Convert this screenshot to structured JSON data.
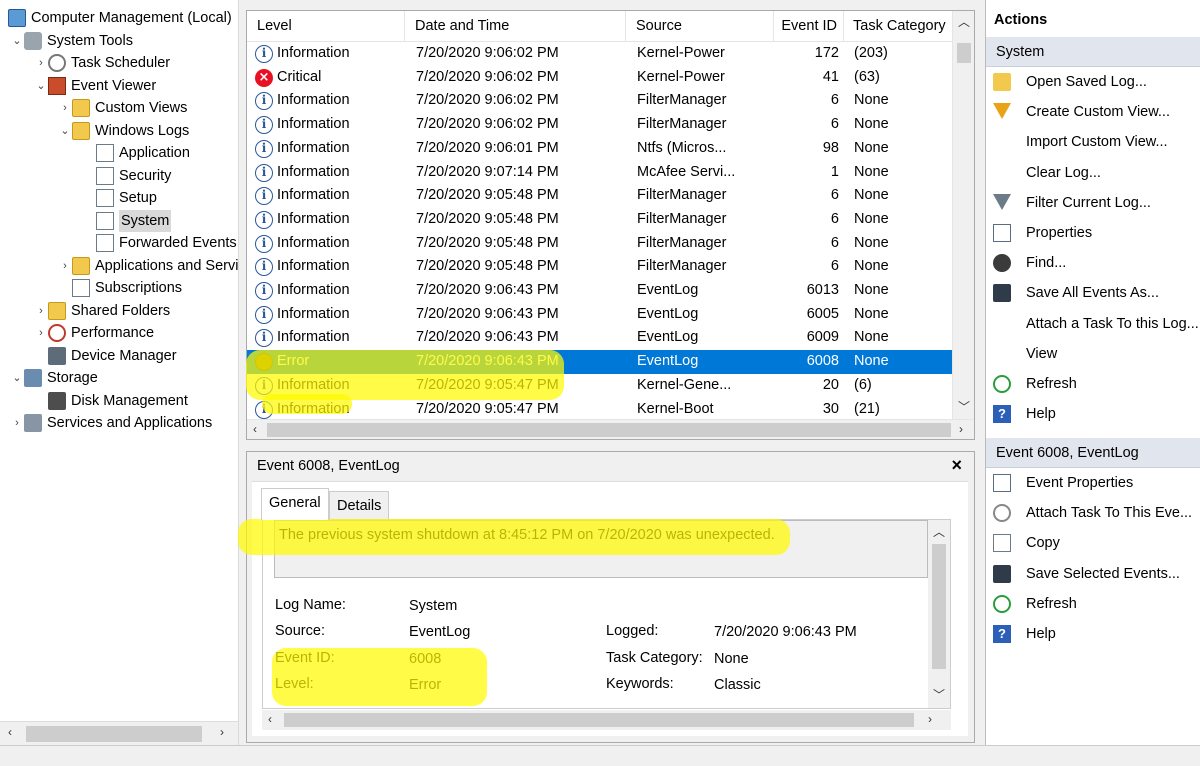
{
  "tree": {
    "items": [
      {
        "label": "Computer Management (Local)",
        "indent": 0,
        "chevron": "",
        "icon": "monitor-icon"
      },
      {
        "label": "System Tools",
        "indent": 1,
        "chevron": "⌄",
        "icon": "tools-icon"
      },
      {
        "label": "Task Scheduler",
        "indent": 2,
        "chevron": "›",
        "icon": "clock-icon"
      },
      {
        "label": "Event Viewer",
        "indent": 2,
        "chevron": "⌄",
        "icon": "event-viewer-icon"
      },
      {
        "label": "Custom Views",
        "indent": 3,
        "chevron": "›",
        "icon": "folder-icon"
      },
      {
        "label": "Windows Logs",
        "indent": 3,
        "chevron": "⌄",
        "icon": "folder-icon"
      },
      {
        "label": "Application",
        "indent": 4,
        "chevron": "",
        "icon": "log-icon"
      },
      {
        "label": "Security",
        "indent": 4,
        "chevron": "",
        "icon": "log-icon"
      },
      {
        "label": "Setup",
        "indent": 4,
        "chevron": "",
        "icon": "log-icon"
      },
      {
        "label": "System",
        "indent": 4,
        "chevron": "",
        "icon": "log-icon"
      },
      {
        "label": "Forwarded Events",
        "indent": 4,
        "chevron": "",
        "icon": "log-icon"
      },
      {
        "label": "Applications and Services Logs",
        "indent": 3,
        "chevron": "›",
        "icon": "folder-icon"
      },
      {
        "label": "Subscriptions",
        "indent": 3,
        "chevron": "",
        "icon": "log-icon"
      },
      {
        "label": "Shared Folders",
        "indent": 2,
        "chevron": "›",
        "icon": "shared-folder-icon"
      },
      {
        "label": "Performance",
        "indent": 2,
        "chevron": "›",
        "icon": "performance-icon"
      },
      {
        "label": "Device Manager",
        "indent": 2,
        "chevron": "",
        "icon": "device-manager-icon"
      },
      {
        "label": "Storage",
        "indent": 1,
        "chevron": "⌄",
        "icon": "storage-icon"
      },
      {
        "label": "Disk Management",
        "indent": 2,
        "chevron": "",
        "icon": "disk-icon"
      },
      {
        "label": "Services and Applications",
        "indent": 1,
        "chevron": "›",
        "icon": "services-icon"
      }
    ],
    "selected": "System"
  },
  "list": {
    "columns": [
      "Level",
      "Date and Time",
      "Source",
      "Event ID",
      "Task Category"
    ],
    "rows": [
      {
        "level": "Information",
        "icon": "info-icon",
        "date": "7/20/2020 9:06:02 PM",
        "source": "Kernel-Power",
        "id": "172",
        "cat": "(203)"
      },
      {
        "level": "Critical",
        "icon": "critical-icon",
        "date": "7/20/2020 9:06:02 PM",
        "source": "Kernel-Power",
        "id": "41",
        "cat": "(63)"
      },
      {
        "level": "Information",
        "icon": "info-icon",
        "date": "7/20/2020 9:06:02 PM",
        "source": "FilterManager",
        "id": "6",
        "cat": "None"
      },
      {
        "level": "Information",
        "icon": "info-icon",
        "date": "7/20/2020 9:06:02 PM",
        "source": "FilterManager",
        "id": "6",
        "cat": "None"
      },
      {
        "level": "Information",
        "icon": "info-icon",
        "date": "7/20/2020 9:06:01 PM",
        "source": "Ntfs (Micros...",
        "id": "98",
        "cat": "None"
      },
      {
        "level": "Information",
        "icon": "info-icon",
        "date": "7/20/2020 9:07:14 PM",
        "source": "McAfee Servi...",
        "id": "1",
        "cat": "None"
      },
      {
        "level": "Information",
        "icon": "info-icon",
        "date": "7/20/2020 9:05:48 PM",
        "source": "FilterManager",
        "id": "6",
        "cat": "None"
      },
      {
        "level": "Information",
        "icon": "info-icon",
        "date": "7/20/2020 9:05:48 PM",
        "source": "FilterManager",
        "id": "6",
        "cat": "None"
      },
      {
        "level": "Information",
        "icon": "info-icon",
        "date": "7/20/2020 9:05:48 PM",
        "source": "FilterManager",
        "id": "6",
        "cat": "None"
      },
      {
        "level": "Information",
        "icon": "info-icon",
        "date": "7/20/2020 9:05:48 PM",
        "source": "FilterManager",
        "id": "6",
        "cat": "None"
      },
      {
        "level": "Information",
        "icon": "info-icon",
        "date": "7/20/2020 9:06:43 PM",
        "source": "EventLog",
        "id": "6013",
        "cat": "None"
      },
      {
        "level": "Information",
        "icon": "info-icon",
        "date": "7/20/2020 9:06:43 PM",
        "source": "EventLog",
        "id": "6005",
        "cat": "None"
      },
      {
        "level": "Information",
        "icon": "info-icon",
        "date": "7/20/2020 9:06:43 PM",
        "source": "EventLog",
        "id": "6009",
        "cat": "None"
      },
      {
        "level": "Error",
        "icon": "error-icon",
        "date": "7/20/2020 9:06:43 PM",
        "source": "EventLog",
        "id": "6008",
        "cat": "None",
        "selected": true
      },
      {
        "level": "Information",
        "icon": "info-icon",
        "date": "7/20/2020 9:05:47 PM",
        "source": "Kernel-Gene...",
        "id": "20",
        "cat": "(6)"
      },
      {
        "level": "Information",
        "icon": "info-icon",
        "date": "7/20/2020 9:05:47 PM",
        "source": "Kernel-Boot",
        "id": "30",
        "cat": "(21)"
      }
    ]
  },
  "detail": {
    "title": "Event 6008, EventLog",
    "close_glyph": "×",
    "tabs": [
      "General",
      "Details"
    ],
    "message": "The previous system shutdown at 8:45:12 PM on 7/20/2020 was unexpected.",
    "log_name_label": "Log Name:",
    "log_name": "System",
    "source_label": "Source:",
    "source": "EventLog",
    "logged_label": "Logged:",
    "logged": "7/20/2020 9:06:43 PM",
    "event_id_label": "Event ID:",
    "event_id": "6008",
    "task_category_label": "Task Category:",
    "task_category": "None",
    "level_label": "Level:",
    "level": "Error",
    "keywords_label": "Keywords:",
    "keywords": "Classic"
  },
  "actions": {
    "title": "Actions",
    "section1": "System",
    "items1": [
      {
        "label": "Open Saved Log...",
        "icon": "open-log-icon"
      },
      {
        "label": "Create Custom View...",
        "icon": "filter-icon"
      },
      {
        "label": "Import Custom View...",
        "icon": ""
      },
      {
        "label": "Clear Log...",
        "icon": ""
      },
      {
        "label": "Filter Current Log...",
        "icon": "filter-log-icon"
      },
      {
        "label": "Properties",
        "icon": "properties-icon"
      },
      {
        "label": "Find...",
        "icon": "find-icon"
      },
      {
        "label": "Save All Events As...",
        "icon": "save-icon"
      },
      {
        "label": "Attach a Task To this Log...",
        "icon": ""
      },
      {
        "label": "View",
        "icon": ""
      },
      {
        "label": "Refresh",
        "icon": "refresh-icon"
      },
      {
        "label": "Help",
        "icon": "help-icon"
      }
    ],
    "section2": "Event 6008, EventLog",
    "items2": [
      {
        "label": "Event Properties",
        "icon": "properties-icon"
      },
      {
        "label": "Attach Task To This Eve...",
        "icon": "task-icon"
      },
      {
        "label": "Copy",
        "icon": "copy-icon"
      },
      {
        "label": "Save Selected Events...",
        "icon": "save-icon"
      },
      {
        "label": "Refresh",
        "icon": "refresh-icon"
      },
      {
        "label": "Help",
        "icon": "help-icon"
      }
    ]
  },
  "colors": {
    "selection": "#0078d7",
    "highlighter": "#fffa00",
    "critical": "#e81123",
    "info": "#2b5797"
  }
}
